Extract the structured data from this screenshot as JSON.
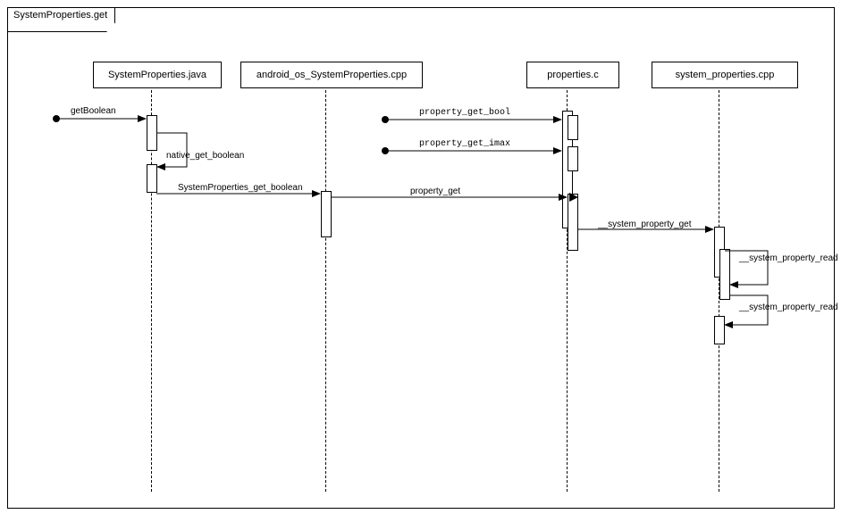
{
  "title": "SystemProperties.get",
  "participants": {
    "p1": "SystemProperties.java",
    "p2": "android_os_SystemProperties.cpp",
    "p3": "properties.c",
    "p4": "system_properties.cpp"
  },
  "messages": {
    "getBoolean": "getBoolean",
    "native_get_boolean": "native_get_boolean",
    "SystemProperties_get_boolean": "SystemProperties_get_boolean",
    "property_get_bool": "property_get_bool",
    "property_get_imax": "property_get_imax",
    "property_get": "property_get",
    "system_property_get": "__system_property_get",
    "system_property_read1": "__system_property_read",
    "system_property_read2": "__system_property_read"
  }
}
